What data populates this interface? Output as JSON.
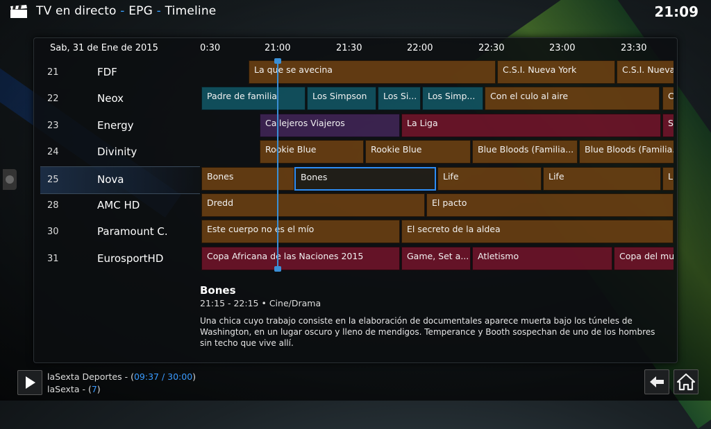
{
  "header": {
    "section": "TV en directo",
    "sep1": "-",
    "crumb1": "EPG",
    "sep2": "-",
    "crumb2": "Timeline",
    "clock": "21:09"
  },
  "epg": {
    "date": "Sab, 31 de Ene de 2015",
    "ticks": [
      {
        "label": "0:30"
      },
      {
        "label": "21:00"
      },
      {
        "label": "21:30"
      },
      {
        "label": "22:00"
      },
      {
        "label": "22:30"
      },
      {
        "label": "23:00"
      },
      {
        "label": "23:30"
      }
    ],
    "channels": [
      {
        "num": "21",
        "name": "FDF"
      },
      {
        "num": "22",
        "name": "Neox"
      },
      {
        "num": "23",
        "name": "Energy"
      },
      {
        "num": "24",
        "name": "Divinity"
      },
      {
        "num": "25",
        "name": "Nova"
      },
      {
        "num": "28",
        "name": "AMC HD"
      },
      {
        "num": "30",
        "name": "Paramount C."
      },
      {
        "num": "31",
        "name": "EurosportHD"
      }
    ],
    "programs": [
      {
        "row": 0,
        "title": "La que se avecina",
        "color": "orange"
      },
      {
        "row": 0,
        "title": "C.S.I. Nueva York",
        "color": "orange"
      },
      {
        "row": 0,
        "title": "C.S.I. Nueva",
        "color": "orange"
      },
      {
        "row": 1,
        "title": "Padre de familia",
        "color": "teal"
      },
      {
        "row": 1,
        "title": "Los Simpson",
        "color": "teal"
      },
      {
        "row": 1,
        "title": "Los Si...",
        "color": "teal"
      },
      {
        "row": 1,
        "title": "Los Simp...",
        "color": "teal"
      },
      {
        "row": 1,
        "title": "Con el culo al aire",
        "color": "orange"
      },
      {
        "row": 1,
        "title": "C",
        "color": "orange"
      },
      {
        "row": 2,
        "title": "Callejeros Viajeros",
        "color": "purple"
      },
      {
        "row": 2,
        "title": "La Liga",
        "color": "red"
      },
      {
        "row": 2,
        "title": "S",
        "color": "red"
      },
      {
        "row": 3,
        "title": "Rookie Blue",
        "color": "orange"
      },
      {
        "row": 3,
        "title": "Rookie Blue",
        "color": "orange"
      },
      {
        "row": 3,
        "title": "Blue Bloods (Familia...",
        "color": "orange"
      },
      {
        "row": 3,
        "title": "Blue Bloods (Familia...",
        "color": "orange"
      },
      {
        "row": 4,
        "title": "Bones",
        "color": "orange"
      },
      {
        "row": 4,
        "title": "Bones",
        "color": "orange",
        "focused": true
      },
      {
        "row": 4,
        "title": "Life",
        "color": "orange"
      },
      {
        "row": 4,
        "title": "Life",
        "color": "orange"
      },
      {
        "row": 4,
        "title": "Li",
        "color": "orange"
      },
      {
        "row": 5,
        "title": "Dredd",
        "color": "orange"
      },
      {
        "row": 5,
        "title": "El pacto",
        "color": "orange"
      },
      {
        "row": 6,
        "title": "Este cuerpo no es el mío",
        "color": "orange"
      },
      {
        "row": 6,
        "title": "El secreto de la aldea",
        "color": "orange"
      },
      {
        "row": 7,
        "title": "Copa Africana de las Naciones 2015",
        "color": "red"
      },
      {
        "row": 7,
        "title": "Game, Set a...",
        "color": "red"
      },
      {
        "row": 7,
        "title": "Atletismo",
        "color": "red"
      },
      {
        "row": 7,
        "title": "Copa del mun",
        "color": "red"
      }
    ]
  },
  "info": {
    "title": "Bones",
    "time": "21:15 - 22:15 • Cine/Drama",
    "description": "Una chica cuyo trabajo consiste en la elaboración de documentales aparece muerta bajo los túneles de Washington, en un lugar oscuro y lleno de mendigos. Temperance y Booth sospechan de uno de los hombres sin techo que vive allí."
  },
  "now_playing": {
    "line1_prefix": "laSexta Deportes - (",
    "line1_time": "09:37 / 30:00",
    "line1_suffix": ")",
    "line2_prefix": "laSexta - (",
    "line2_num": "7",
    "line2_suffix": ")"
  },
  "colors": {
    "accent": "#3a9bff",
    "orange": "#784612",
    "teal": "#125f6e",
    "purple": "#46285f",
    "red": "#7d142d"
  }
}
